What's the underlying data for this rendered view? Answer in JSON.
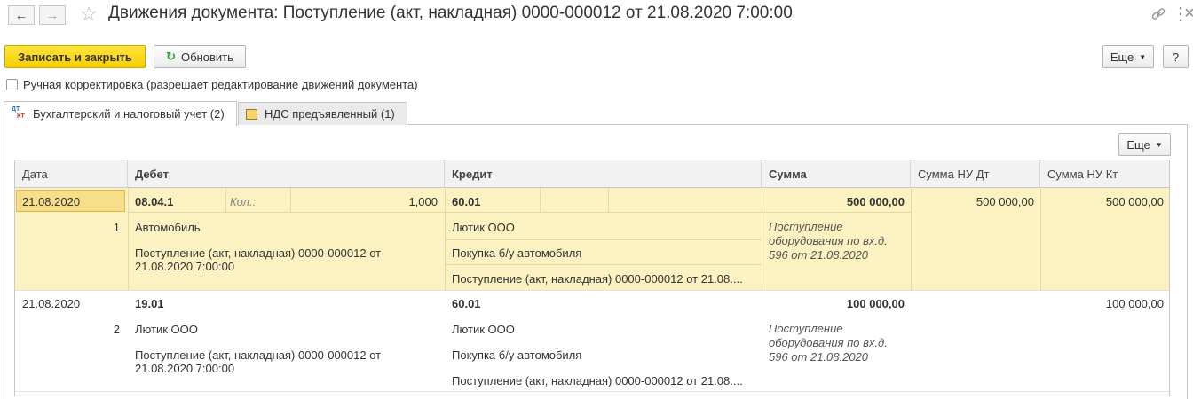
{
  "window": {
    "title": "Движения документа: Поступление (акт, накладная) 0000-000012 от 21.08.2020 7:00:00"
  },
  "toolbar": {
    "save_close": "Записать и закрыть",
    "refresh": "Обновить",
    "more": "Еще",
    "help": "?"
  },
  "manual": {
    "label": "Ручная корректировка (разрешает редактирование движений документа)",
    "checked": false
  },
  "tabs": [
    {
      "label": "Бухгалтерский и налоговый учет (2)",
      "icon": "dt-kt-icon",
      "active": true
    },
    {
      "label": "НДС предъявленный (1)",
      "icon": "register-icon",
      "active": false
    }
  ],
  "table_toolbar": {
    "more": "Еще"
  },
  "table": {
    "columns": [
      "Дата",
      "Дебет",
      "Кредит",
      "Сумма",
      "Сумма НУ Дт",
      "Сумма НУ Кт"
    ],
    "rows": [
      {
        "date": "21.08.2020",
        "num": "1",
        "debit_account": "08.04.1",
        "qty_label": "Кол.:",
        "qty_value": "1,000",
        "debit_subconto1": "Автомобиль",
        "debit_subconto2": "Поступление (акт, накладная) 0000-000012 от 21.08.2020 7:00:00",
        "credit_account": "60.01",
        "credit_subconto1": "Лютик ООО",
        "credit_subconto2": "Покупка б/у автомобиля",
        "credit_subconto3": "Поступление (акт, накладная) 0000-000012 от 21.08....",
        "sum": "500 000,00",
        "content": "Поступление оборудования по вх.д. 596 от 21.08.2020",
        "sum_nu_dt": "500 000,00",
        "sum_nu_kt": "500 000,00"
      },
      {
        "date": "21.08.2020",
        "num": "2",
        "debit_account": "19.01",
        "debit_subconto1": "Лютик ООО",
        "debit_subconto2": "Поступление (акт, накладная) 0000-000012 от 21.08.2020 7:00:00",
        "credit_account": "60.01",
        "credit_subconto1": "Лютик ООО",
        "credit_subconto2": "Покупка б/у автомобиля",
        "credit_subconto3": "Поступление (акт, накладная) 0000-000012 от 21.08....",
        "sum": "100 000,00",
        "content": "Поступление оборудования по вх.д. 596 от 21.08.2020",
        "sum_nu_dt": "",
        "sum_nu_kt": "100 000,00"
      }
    ]
  },
  "colors": {
    "selected_row": "#fbf1c1",
    "selected_cell": "#f7de88",
    "primary_button": "#f5d100"
  }
}
